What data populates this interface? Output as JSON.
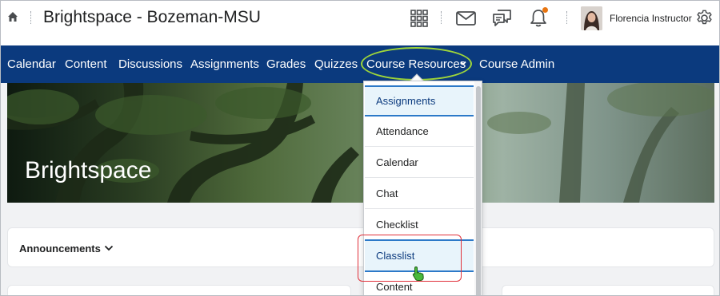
{
  "header": {
    "org_title": "Brightspace - Bozeman-MSU",
    "user_name": "Florencia Instructor",
    "icons": [
      "home-icon",
      "waffle-icon",
      "mail-icon",
      "chat-icon",
      "bell-icon",
      "gear-icon"
    ],
    "notification_color": "#e87511"
  },
  "nav": {
    "items": [
      "Calendar",
      "Content",
      "Discussions",
      "Assignments",
      "Grades",
      "Quizzes",
      "Course Resources",
      "Course Admin"
    ],
    "background": "#0b3a7e",
    "active_item": "Course Resources"
  },
  "banner": {
    "title": "Brightspace"
  },
  "widgets": {
    "announcements": "Announcements"
  },
  "dropdown": {
    "items": [
      "Assignments",
      "Attendance",
      "Calendar",
      "Chat",
      "Checklist",
      "Classlist",
      "Content"
    ],
    "selected": "Assignments",
    "hovered": "Classlist"
  },
  "colors": {
    "accent": "#0b3a7e",
    "highlight_oval": "#9fd63a",
    "callout_box": "#e0303a",
    "cursor": "#49b83b"
  }
}
